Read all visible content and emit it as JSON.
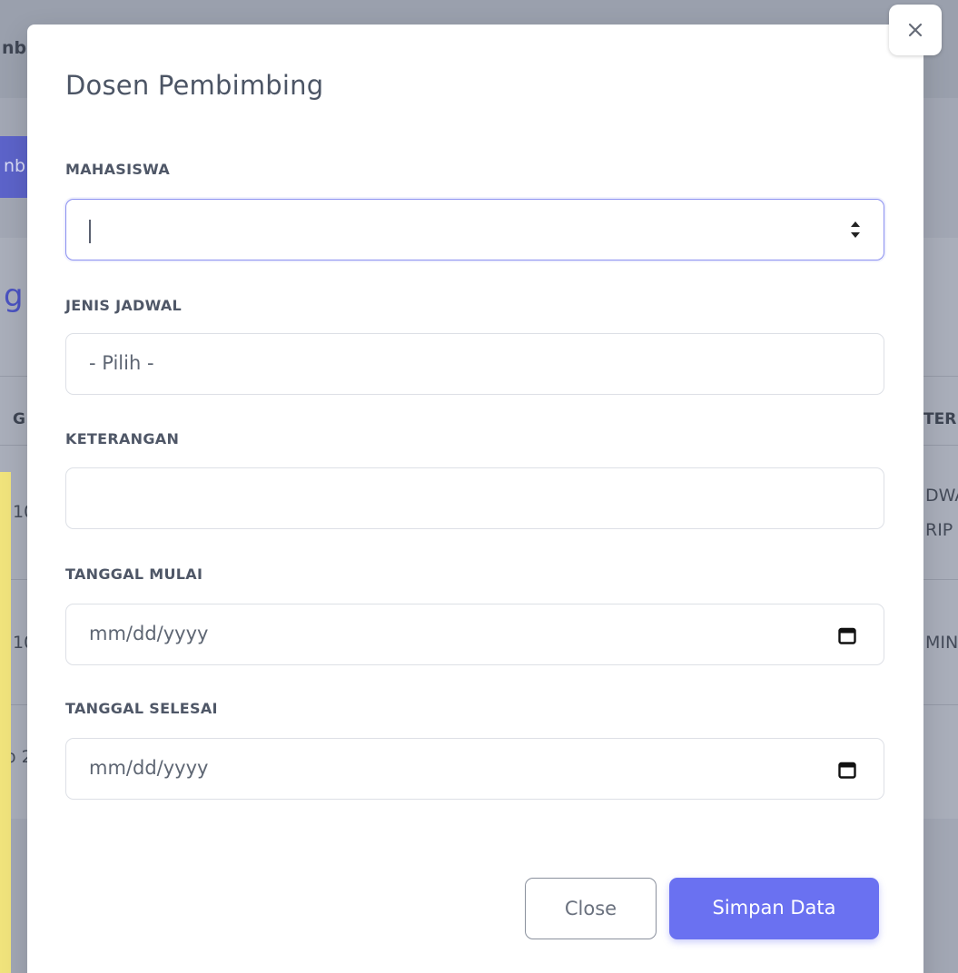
{
  "background": {
    "crumb_fragment": "nb",
    "button_fragment": "nb",
    "heading_fragment": "g",
    "header_left_fragment": "G",
    "header_right_fragment": "TER",
    "row1_left": "10",
    "row1_right_line1": "DWA",
    "row1_right_line2": "RIP",
    "row2_left": "10",
    "row2_right": "MIN",
    "row3_left": "o 2"
  },
  "modal": {
    "title": "Dosen Pembimbing",
    "fields": {
      "mahasiswa": {
        "label": "MAHASISWA",
        "value": ""
      },
      "jenis_jadwal": {
        "label": "JENIS JADWAL",
        "selected": "- Pilih -"
      },
      "keterangan": {
        "label": "KETERANGAN",
        "value": ""
      },
      "tanggal_mulai": {
        "label": "TANGGAL MULAI",
        "placeholder": "mm/dd/yyyy"
      },
      "tanggal_selesai": {
        "label": "TANGGAL SELESAI",
        "placeholder": "mm/dd/yyyy"
      }
    },
    "buttons": {
      "close": "Close",
      "save": "Simpan Data"
    }
  },
  "colors": {
    "accent": "#6a71f1",
    "focus_border": "#8a8ff0",
    "overlay": "#a2a7b4"
  },
  "icons": [
    "close-icon",
    "spinner-arrows-icon",
    "calendar-icon"
  ]
}
